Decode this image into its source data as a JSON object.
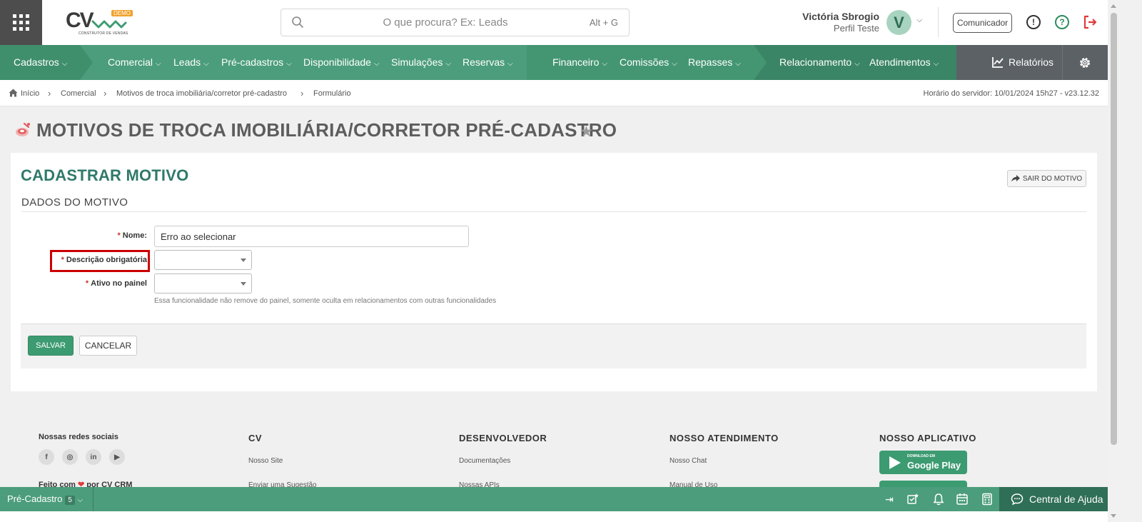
{
  "header": {
    "logo_text": "CV",
    "logo_badge": "DEMO",
    "logo_subtitle": "CONSTRUTOR DE VENDAS",
    "search_placeholder": "O que procura? Ex: Leads",
    "search_shortcut": "Alt + G",
    "user_name": "Victória Sbrogio",
    "user_profile": "Perfil Teste",
    "avatar_letter": "V",
    "comunicador_label": "Comunicador",
    "icons": [
      "apps-grid-icon",
      "search-icon",
      "chevron-down-icon",
      "info-icon",
      "help-icon",
      "logout-icon"
    ],
    "logout_color": "#e03a3a"
  },
  "nav": {
    "items": [
      {
        "label": "Cadastros"
      },
      {
        "label": "Comercial"
      },
      {
        "label": "Leads"
      },
      {
        "label": "Pré-cadastros"
      },
      {
        "label": "Disponibilidade"
      },
      {
        "label": "Simulações"
      },
      {
        "label": "Reservas"
      },
      {
        "label": "Financeiro"
      },
      {
        "label": "Comissões"
      },
      {
        "label": "Repasses"
      },
      {
        "label": "Relacionamento"
      },
      {
        "label": "Atendimentos"
      }
    ],
    "relatorios_label": "Relatórios",
    "accent_color": "#4b9d7b"
  },
  "breadcrumb": {
    "items": [
      "Início",
      "Comercial",
      "Motivos de troca imobiliária/corretor pré-cadastro",
      "Formulário"
    ],
    "server_time": "Horário do servidor: 10/01/2024 15h27 - v23.12.32"
  },
  "page": {
    "title": "MOTIVOS DE TROCA IMOBILIÁRIA/CORRETOR PRÉ-CADASTRO"
  },
  "form": {
    "title": "CADASTRAR MOTIVO",
    "exit_label": "SAIR DO MOTIVO",
    "section_title": "DADOS DO MOTIVO",
    "required_mark": "*",
    "fields": {
      "nome_label": "Nome:",
      "nome_value": "Erro ao selecionar",
      "descricao_label": "Descrição obrigatória",
      "descricao_value": "",
      "ativo_label": "Ativo no painel",
      "ativo_value": "",
      "ativo_help": "Essa funcionalidade não remove do painel, somente oculta em relacionamentos com outras funcionalidades"
    },
    "save_label": "SALVAR",
    "cancel_label": "CANCELAR"
  },
  "footer": {
    "social_title": "Nossas redes sociais",
    "social_icons": [
      "facebook-icon",
      "instagram-icon",
      "linkedin-icon",
      "youtube-icon"
    ],
    "social_glyphs": [
      "f",
      "◎",
      "in",
      "▶"
    ],
    "made_with_prefix": "Feito com",
    "made_with_suffix": "por CV CRM",
    "cols": [
      {
        "title": "CV",
        "links": [
          "Nosso Site",
          "Enviar uma Sugestão"
        ]
      },
      {
        "title": "DESENVOLVEDOR",
        "links": [
          "Documentações",
          "Nossas APIs"
        ]
      },
      {
        "title": "NOSSO ATENDIMENTO",
        "links": [
          "Nosso Chat",
          "Manual de Uso"
        ]
      },
      {
        "title": "NOSSO APLICATIVO",
        "links": []
      }
    ],
    "google_play_small": "DOWNLOAD EM",
    "google_play_big": "Google Play"
  },
  "bottombar": {
    "module_label": "Pré-Cadastro",
    "module_count": "5",
    "help_label": "Central de Ajuda"
  }
}
